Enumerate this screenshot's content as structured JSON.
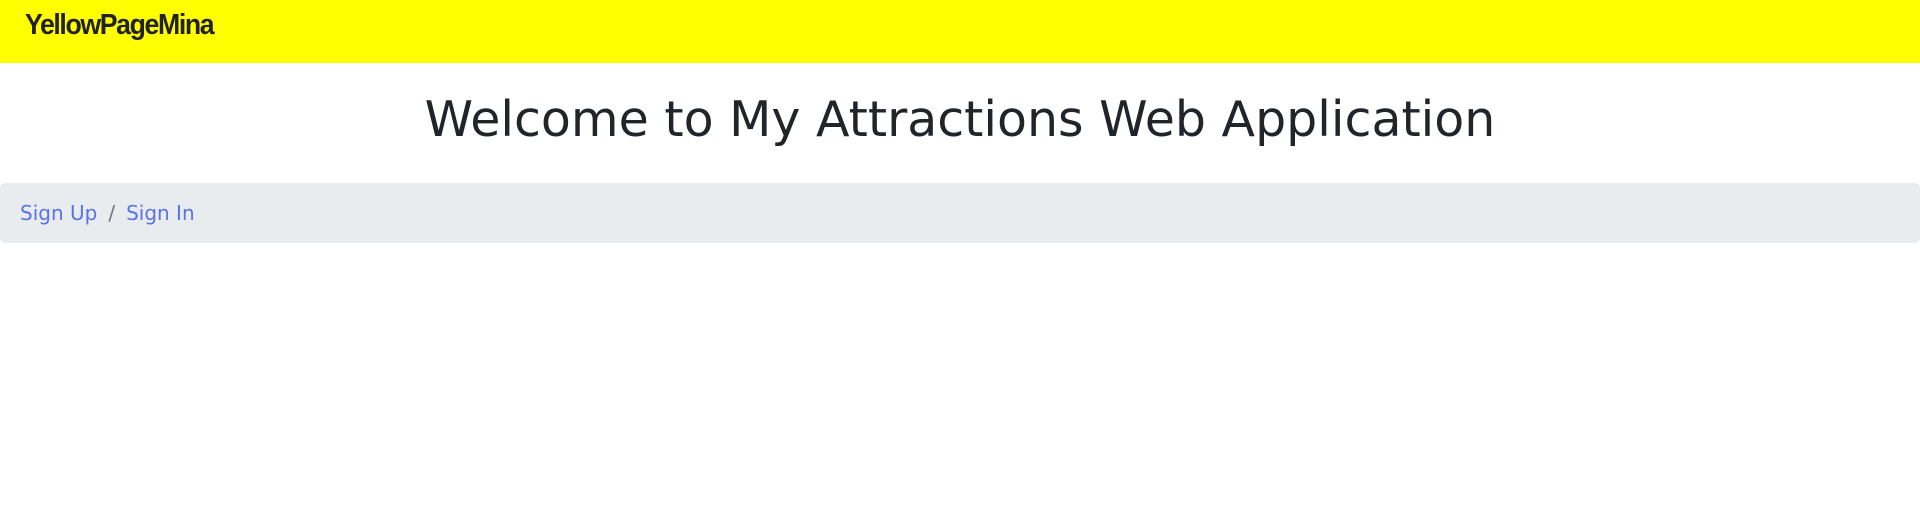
{
  "navbar": {
    "brand": "YellowPageMina"
  },
  "main": {
    "heading": "Welcome to My Attractions Web Application"
  },
  "breadcrumb": {
    "items": [
      {
        "label": "Sign Up"
      },
      {
        "label": "Sign In"
      }
    ],
    "separator": "/"
  },
  "colors": {
    "navbar_background": "#ffff00",
    "breadcrumb_background": "#e9ecef",
    "link": "#5a72ea",
    "heading_text": "#212529"
  }
}
